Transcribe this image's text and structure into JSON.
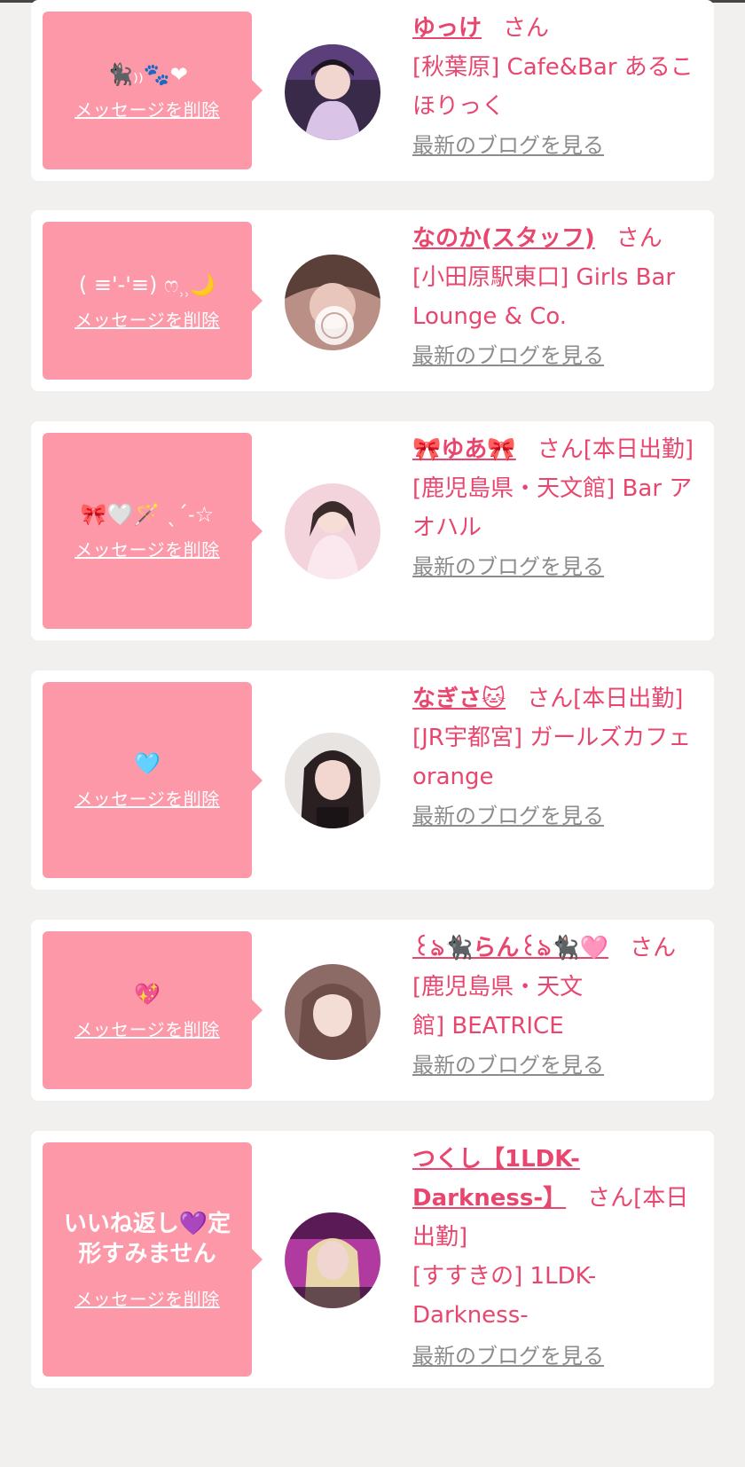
{
  "delete_label": "メッセージを削除",
  "san_label": "さん",
  "blog_label": "最新のブログを見る",
  "entries": [
    {
      "message": "🐈‍⬛₎₎🐾❤",
      "name": "ゆっけ",
      "suffix": "さん",
      "shop": "[秋葉原] Cafe&Bar あるこほりっく",
      "avatar_color": "#3a2a4a"
    },
    {
      "message": "( ≡'-'≡) ෆ⸒⸒🌙",
      "name": "なのか(スタッフ)",
      "suffix": "さん",
      "shop": "[小田原駅東口] Girls Bar Lounge & Co.",
      "avatar_color": "#b98f86"
    },
    {
      "message": "🎀🤍🪄 ˎˊ˗☆",
      "name": "🎀ゆあ🎀",
      "suffix": "さん[本日出勤]",
      "shop": "[鹿児島県・天文館] Bar アオハル",
      "avatar_color": "#f3d4dc"
    },
    {
      "message": "🩵",
      "name": "なぎさ🐱",
      "suffix": "さん[本日出勤]",
      "shop": "[JR宇都宮] ガールズカフェ orange",
      "avatar_color": "#4a3b36"
    },
    {
      "message": "💖",
      "name": "꒰ঌ🐈‍⬛らん꒰ঌ🐈‍⬛🩷",
      "suffix": "さん",
      "shop": "[鹿児島県・天文館] BEATRICE",
      "avatar_color": "#8c6b66"
    },
    {
      "message": "いいね返し💜定形すみません",
      "name": "つくし【1LDK-Darkness-】",
      "suffix": "さん[本日出勤]",
      "shop": "[すすきの] 1LDK-Darkness-",
      "avatar_color": "#b03aa0"
    }
  ]
}
